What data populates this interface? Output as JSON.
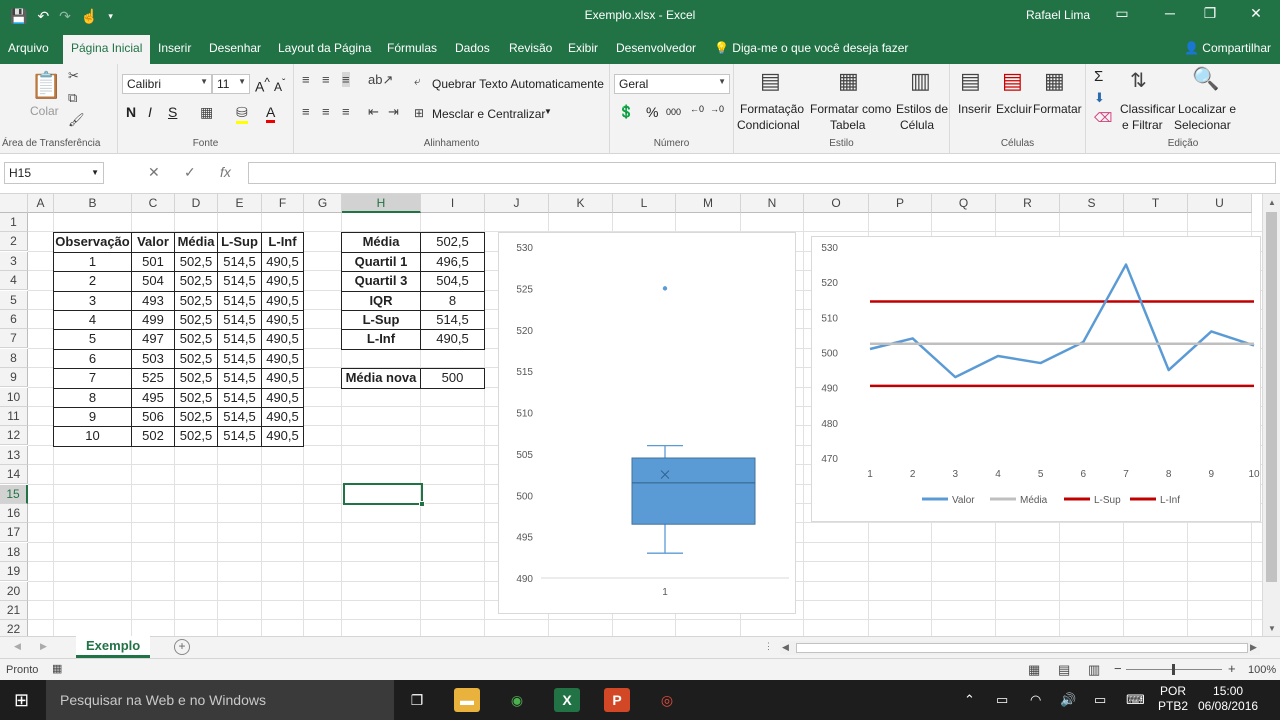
{
  "window": {
    "title": "Exemplo.xlsx - Excel",
    "user": "Rafael Lima"
  },
  "colors": {
    "excel_green": "#217346",
    "box_fill": "#5b9bd5",
    "valor_line": "#5b9bd5",
    "media_line": "#bfbfbf",
    "limit_line": "#c00000"
  },
  "tabs": [
    "Arquivo",
    "Página Inicial",
    "Inserir",
    "Desenhar",
    "Layout da Página",
    "Fórmulas",
    "Dados",
    "Revisão",
    "Exibir",
    "Desenvolvedor"
  ],
  "tell_me": "Diga-me o que você deseja fazer",
  "share": "Compartilhar",
  "ribbon": {
    "clipboard": {
      "paste": "Colar",
      "label": "Área de Transferência"
    },
    "font": {
      "name": "Calibri",
      "size": "11",
      "bold": "N",
      "italic": "I",
      "underline": "S",
      "label": "Fonte"
    },
    "alignment": {
      "wrap": "Quebrar Texto Automaticamente",
      "merge": "Mesclar e Centralizar",
      "label": "Alinhamento"
    },
    "number": {
      "format": "Geral",
      "label": "Número"
    },
    "styles": {
      "conditional_1": "Formatação",
      "conditional_2": "Condicional",
      "table_1": "Formatar como",
      "table_2": "Tabela",
      "cell_1": "Estilos de",
      "cell_2": "Célula",
      "label": "Estilo"
    },
    "cells": {
      "insert": "Inserir",
      "delete": "Excluir",
      "format": "Formatar",
      "label": "Células"
    },
    "editing": {
      "sort_1": "Classificar",
      "sort_2": "e Filtrar",
      "find_1": "Localizar e",
      "find_2": "Selecionar",
      "label": "Edição"
    }
  },
  "formula_bar": {
    "name_box": "H15",
    "formula": ""
  },
  "columns": [
    "A",
    "B",
    "C",
    "D",
    "E",
    "F",
    "G",
    "H",
    "I",
    "J",
    "K",
    "L",
    "M",
    "N",
    "O",
    "P",
    "Q",
    "R",
    "S",
    "T",
    "U"
  ],
  "rows": [
    "1",
    "2",
    "3",
    "4",
    "5",
    "6",
    "7",
    "8",
    "9",
    "10",
    "11",
    "12",
    "13",
    "14",
    "15",
    "16",
    "17",
    "18",
    "19",
    "20",
    "21",
    "22"
  ],
  "selected": {
    "column": "H",
    "row": "15"
  },
  "table": {
    "headers": [
      "Observação",
      "Valor",
      "Média",
      "L-Sup",
      "L-Inf"
    ],
    "rows": [
      [
        "1",
        "501",
        "502,5",
        "514,5",
        "490,5"
      ],
      [
        "2",
        "504",
        "502,5",
        "514,5",
        "490,5"
      ],
      [
        "3",
        "493",
        "502,5",
        "514,5",
        "490,5"
      ],
      [
        "4",
        "499",
        "502,5",
        "514,5",
        "490,5"
      ],
      [
        "5",
        "497",
        "502,5",
        "514,5",
        "490,5"
      ],
      [
        "6",
        "503",
        "502,5",
        "514,5",
        "490,5"
      ],
      [
        "7",
        "525",
        "502,5",
        "514,5",
        "490,5"
      ],
      [
        "8",
        "495",
        "502,5",
        "514,5",
        "490,5"
      ],
      [
        "9",
        "506",
        "502,5",
        "514,5",
        "490,5"
      ],
      [
        "10",
        "502",
        "502,5",
        "514,5",
        "490,5"
      ]
    ]
  },
  "stats": [
    [
      "Média",
      "502,5"
    ],
    [
      "Quartil 1",
      "496,5"
    ],
    [
      "Quartil 3",
      "504,5"
    ],
    [
      "IQR",
      "8"
    ],
    [
      "L-Sup",
      "514,5"
    ],
    [
      "L-Inf",
      "490,5"
    ]
  ],
  "new_mean": {
    "label": "Média nova",
    "value": "500"
  },
  "sheet": {
    "tab": "Exemplo"
  },
  "status": {
    "ready": "Pronto",
    "zoom": "100%"
  },
  "taskbar": {
    "search": "Pesquisar na Web e no Windows",
    "lang_1": "POR",
    "lang_2": "PTB2",
    "time": "15:00",
    "date": "06/08/2016"
  },
  "chart_data": [
    {
      "type": "box",
      "ylim": [
        490,
        530
      ],
      "yticks": [
        490,
        495,
        500,
        505,
        510,
        515,
        520,
        525,
        530
      ],
      "categories": [
        "1"
      ],
      "box": {
        "whisker_low": 493,
        "q1": 496.5,
        "median": 501.5,
        "mean": 502.5,
        "q3": 504.5,
        "whisker_high": 506,
        "outliers": [
          525
        ]
      }
    },
    {
      "type": "line",
      "x": [
        "1",
        "2",
        "3",
        "4",
        "5",
        "6",
        "7",
        "8",
        "9",
        "10"
      ],
      "ylim": [
        470,
        530
      ],
      "yticks": [
        470,
        480,
        490,
        500,
        510,
        520,
        530
      ],
      "series": [
        {
          "name": "Valor",
          "values": [
            501,
            504,
            493,
            499,
            497,
            503,
            525,
            495,
            506,
            502
          ]
        },
        {
          "name": "Média",
          "values": [
            502.5,
            502.5,
            502.5,
            502.5,
            502.5,
            502.5,
            502.5,
            502.5,
            502.5,
            502.5
          ]
        },
        {
          "name": "L-Sup",
          "values": [
            514.5,
            514.5,
            514.5,
            514.5,
            514.5,
            514.5,
            514.5,
            514.5,
            514.5,
            514.5
          ]
        },
        {
          "name": "L-Inf",
          "values": [
            490.5,
            490.5,
            490.5,
            490.5,
            490.5,
            490.5,
            490.5,
            490.5,
            490.5,
            490.5
          ]
        }
      ]
    }
  ]
}
